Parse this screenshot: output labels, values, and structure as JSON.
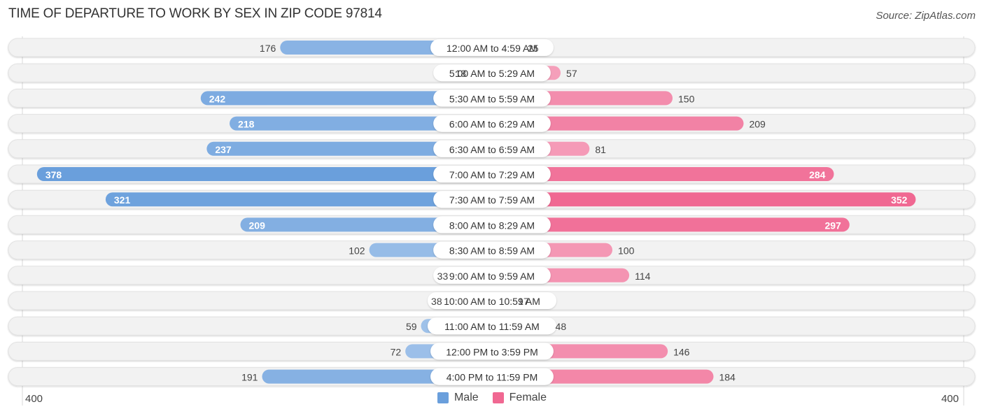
{
  "header": {
    "title": "TIME OF DEPARTURE TO WORK BY SEX IN ZIP CODE 97814",
    "source": "Source: ZipAtlas.com"
  },
  "colors": {
    "male": "#6a9fdc",
    "male_light": "#a9c8ec",
    "female": "#f06892",
    "female_light": "#f6aac2",
    "track": "#f2f2f2",
    "label_bg": "#ffffff"
  },
  "legend": [
    {
      "name": "Male",
      "color": "#6a9fdc"
    },
    {
      "name": "Female",
      "color": "#f06892"
    }
  ],
  "axis": {
    "left_label": "400",
    "right_label": "400"
  },
  "chart_data": {
    "type": "bar",
    "orientation": "horizontal-diverging",
    "title": "TIME OF DEPARTURE TO WORK BY SEX IN ZIP CODE 97814",
    "xlabel": "",
    "ylabel": "",
    "xlim": [
      -400,
      400
    ],
    "grid": false,
    "legend_position": "bottom-center",
    "categories": [
      "12:00 AM to 4:59 AM",
      "5:00 AM to 5:29 AM",
      "5:30 AM to 5:59 AM",
      "6:00 AM to 6:29 AM",
      "6:30 AM to 6:59 AM",
      "7:00 AM to 7:29 AM",
      "7:30 AM to 7:59 AM",
      "8:00 AM to 8:29 AM",
      "8:30 AM to 8:59 AM",
      "9:00 AM to 9:59 AM",
      "10:00 AM to 10:59 AM",
      "11:00 AM to 11:59 AM",
      "12:00 PM to 3:59 PM",
      "4:00 PM to 11:59 PM"
    ],
    "series": [
      {
        "name": "Male",
        "values": [
          176,
          18,
          242,
          218,
          237,
          378,
          321,
          209,
          102,
          33,
          38,
          59,
          72,
          191
        ]
      },
      {
        "name": "Female",
        "values": [
          25,
          57,
          150,
          209,
          81,
          284,
          352,
          297,
          100,
          114,
          17,
          48,
          146,
          184
        ]
      }
    ]
  }
}
